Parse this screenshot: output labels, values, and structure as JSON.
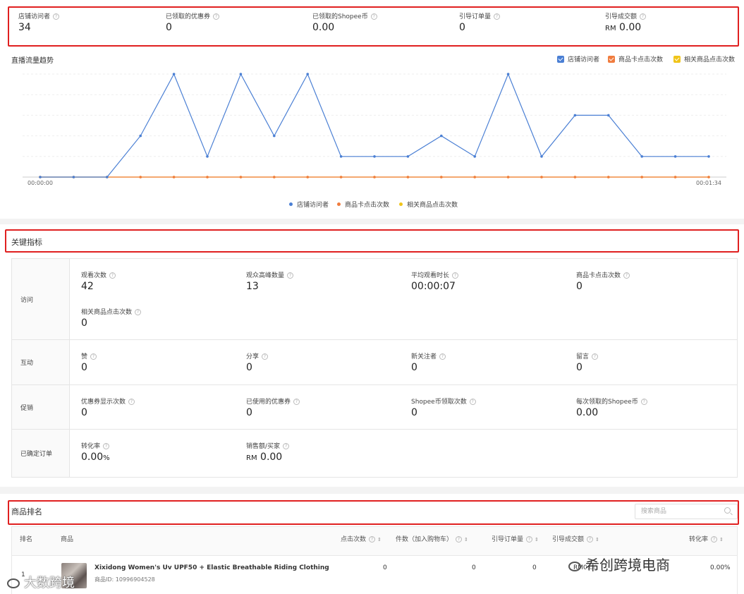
{
  "top_stats": [
    {
      "label": "店铺访问者",
      "value": "34",
      "unit": ""
    },
    {
      "label": "已领取的优惠券",
      "value": "0",
      "unit": ""
    },
    {
      "label": "已领取的Shopee币",
      "value": "0.00",
      "unit": ""
    },
    {
      "label": "引导订单量",
      "value": "0",
      "unit": ""
    },
    {
      "label": "引导成交额",
      "value": "0.00",
      "unit": "RM"
    }
  ],
  "trend": {
    "title": "直播流量趋势",
    "legend_top": [
      "店铺访问者",
      "商品卡点击次数",
      "相关商品点击次数"
    ],
    "legend_bottom": [
      "店铺访问者",
      "商品卡点击次数",
      "相关商品点击次数"
    ],
    "x_start_label": "00:00:00",
    "x_end_label": "00:01:34",
    "colors": {
      "visitors": "#4a7fd4",
      "card_clicks": "#f07c3e",
      "related_clicks": "#f0c419"
    }
  },
  "chart_data": {
    "type": "line",
    "x": [
      0,
      1,
      2,
      3,
      4,
      5,
      6,
      7,
      8,
      9,
      10,
      11,
      12,
      13,
      14,
      15,
      16,
      17,
      18,
      19
    ],
    "series": [
      {
        "name": "店铺访问者",
        "values": [
          0,
          0,
          0,
          2,
          5,
          1,
          5,
          2,
          5,
          1,
          1,
          1,
          2,
          1,
          5,
          1,
          3,
          3,
          1,
          1,
          1
        ]
      },
      {
        "name": "商品卡点击次数",
        "values": [
          0,
          0,
          0,
          0,
          0,
          0,
          0,
          0,
          0,
          0,
          0,
          0,
          0,
          0,
          0,
          0,
          0,
          0,
          0,
          0,
          0
        ]
      },
      {
        "name": "相关商品点击次数",
        "values": [
          0,
          0,
          0,
          0,
          0,
          0,
          0,
          0,
          0,
          0,
          0,
          0,
          0,
          0,
          0,
          0,
          0,
          0,
          0,
          0,
          0
        ]
      }
    ],
    "ylim": [
      0,
      5
    ],
    "grid": true,
    "legend": "top-right"
  },
  "key_metrics": {
    "title": "关键指标",
    "groups": [
      {
        "label": "访问",
        "items": [
          {
            "label": "观看次数",
            "value": "42"
          },
          {
            "label": "观众高峰数量",
            "value": "13"
          },
          {
            "label": "平均观看时长",
            "value": "00:00:07"
          },
          {
            "label": "商品卡点击次数",
            "value": "0"
          },
          {
            "label": "相关商品点击次数",
            "value": "0"
          }
        ]
      },
      {
        "label": "互动",
        "items": [
          {
            "label": "赞",
            "value": "0"
          },
          {
            "label": "分享",
            "value": "0"
          },
          {
            "label": "新关注者",
            "value": "0"
          },
          {
            "label": "留言",
            "value": "0"
          }
        ]
      },
      {
        "label": "促销",
        "items": [
          {
            "label": "优惠券显示次数",
            "value": "0"
          },
          {
            "label": "已使用的优惠券",
            "value": "0"
          },
          {
            "label": "Shopee币领取次数",
            "value": "0"
          },
          {
            "label": "每次领取的Shopee币",
            "value": "0.00"
          }
        ]
      },
      {
        "label": "已确定订单",
        "items": [
          {
            "label": "转化率",
            "value": "0.00",
            "suffix": "%"
          },
          {
            "label": "销售额/买家",
            "value": "0.00",
            "prefix": "RM"
          }
        ]
      }
    ]
  },
  "ranking": {
    "title": "商品排名",
    "search_placeholder": "搜索商品",
    "columns": [
      "排名",
      "商品",
      "点击次数",
      "件数（加入购物车）",
      "引导订单量",
      "引导成交额",
      "转化率"
    ],
    "rows": [
      {
        "rank": "1",
        "name": "Xixidong Women's Uv UPF50 + Elastic Breathable Riding Clothing",
        "product_id": "商品ID: 10996904528",
        "clicks": "0",
        "add_to_cart": "0",
        "orders": "0",
        "sales": "RM0.00",
        "conversion": "0.00%"
      }
    ]
  },
  "watermarks": {
    "left": "大数跨境",
    "right": "希创跨境电商"
  }
}
